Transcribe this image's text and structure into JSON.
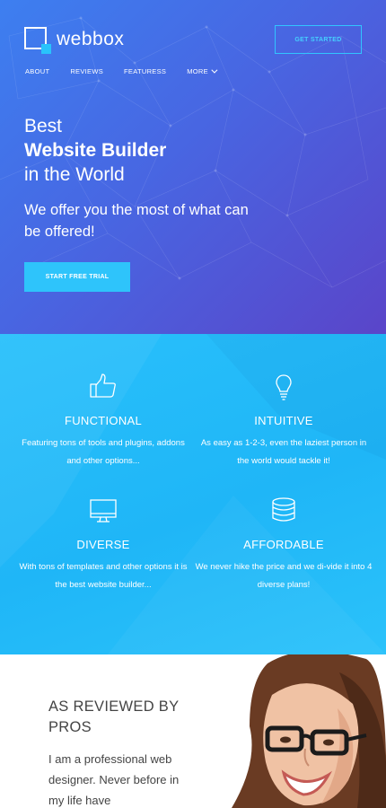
{
  "brand": {
    "logo_text": "webbox",
    "accent": "#29c3fb"
  },
  "header": {
    "cta_label": "GET STARTED",
    "nav": [
      {
        "label": "ABOUT"
      },
      {
        "label": "REVIEWS"
      },
      {
        "label": "FEATURESS"
      },
      {
        "label": "MORE"
      }
    ]
  },
  "hero": {
    "line1": "Best",
    "line2": "Website Builder",
    "line3": "in the World",
    "subtitle": "We offer you the most of what can be offered!",
    "cta_label": "START FREE TRIAL"
  },
  "features": [
    {
      "title": "FUNCTIONAL",
      "desc": "Featuring tons of tools and plugins, addons and other options...",
      "icon": "thumbs-up-icon"
    },
    {
      "title": "INTUITIVE",
      "desc": "As easy as 1-2-3, even the laziest person in the world would tackle it!",
      "icon": "lightbulb-icon"
    },
    {
      "title": "DIVERSE",
      "desc": "With tons of templates and other options it is the best website builder...",
      "icon": "monitor-icon"
    },
    {
      "title": "AFFORDABLE",
      "desc": "We never hike the price and we di-vide it into 4 diverse plans!",
      "icon": "coins-icon"
    }
  ],
  "review": {
    "title": "AS REVIEWED BY PROS",
    "quote": "I am a professional web designer. Never before in my life have"
  }
}
